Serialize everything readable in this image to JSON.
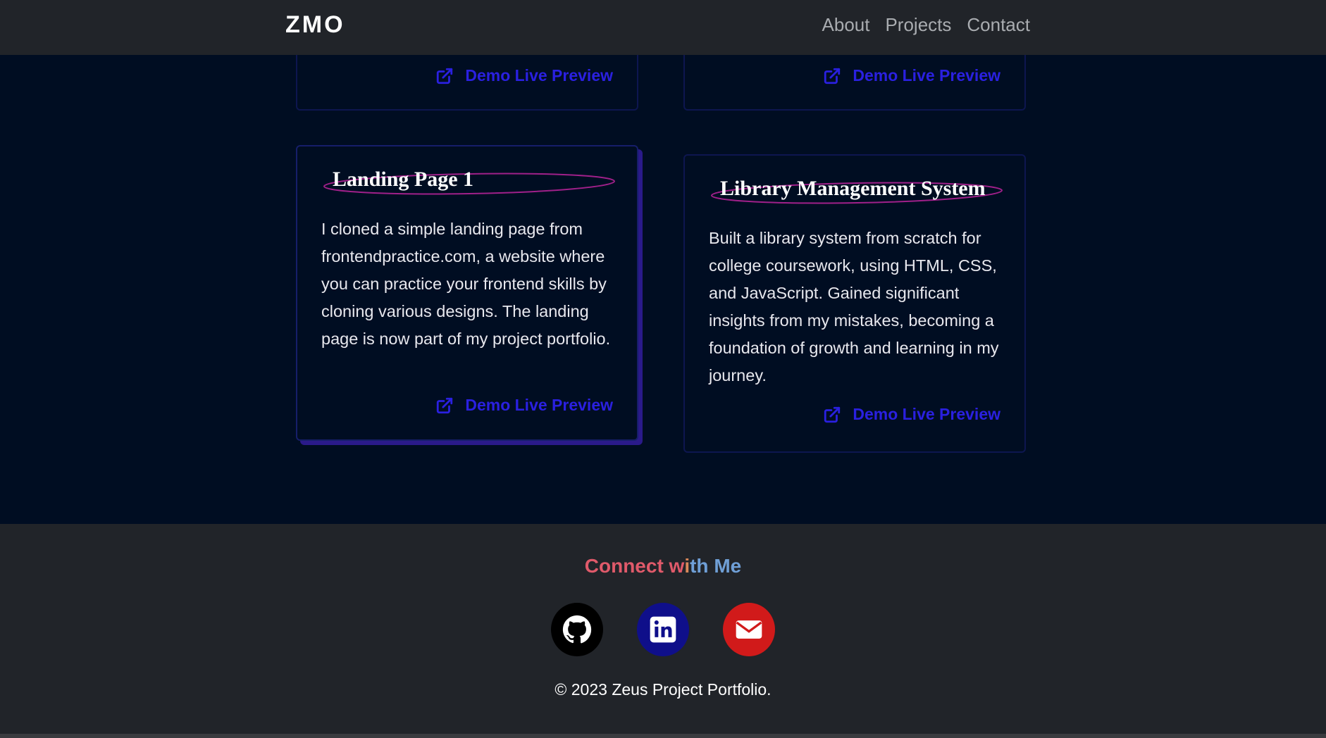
{
  "navbar": {
    "brand": "ZMO",
    "links": [
      "About",
      "Projects",
      "Contact"
    ]
  },
  "projects": {
    "demo_label": "Demo Live Preview",
    "cards": [
      {
        "title": "Landing Page 1",
        "description": "I cloned a simple landing page from frontendpractice.com, a website where you can practice your frontend skills by cloning various designs. The landing page is now part of my project portfolio."
      },
      {
        "title": "Library Management System",
        "description": "Built a library system from scratch for college coursework, using HTML, CSS, and JavaScript. Gained significant insights from my mistakes, becoming a foundation of growth and learning in my journey."
      }
    ]
  },
  "footer": {
    "connect_part1": "Connect w",
    "connect_part2": "i",
    "connect_part3": "th Me",
    "socials": [
      {
        "name": "github-icon",
        "color": "#000000"
      },
      {
        "name": "linkedin-icon",
        "color": "#0f0f8a"
      },
      {
        "name": "email-icon",
        "color": "#d11a1a"
      }
    ],
    "copyright": "© 2023 Zeus Project Portfolio."
  },
  "colors": {
    "background": "#000d22",
    "navbar": "#212429",
    "accent_link": "#2a20e0",
    "title_ring": "#a0208a"
  }
}
